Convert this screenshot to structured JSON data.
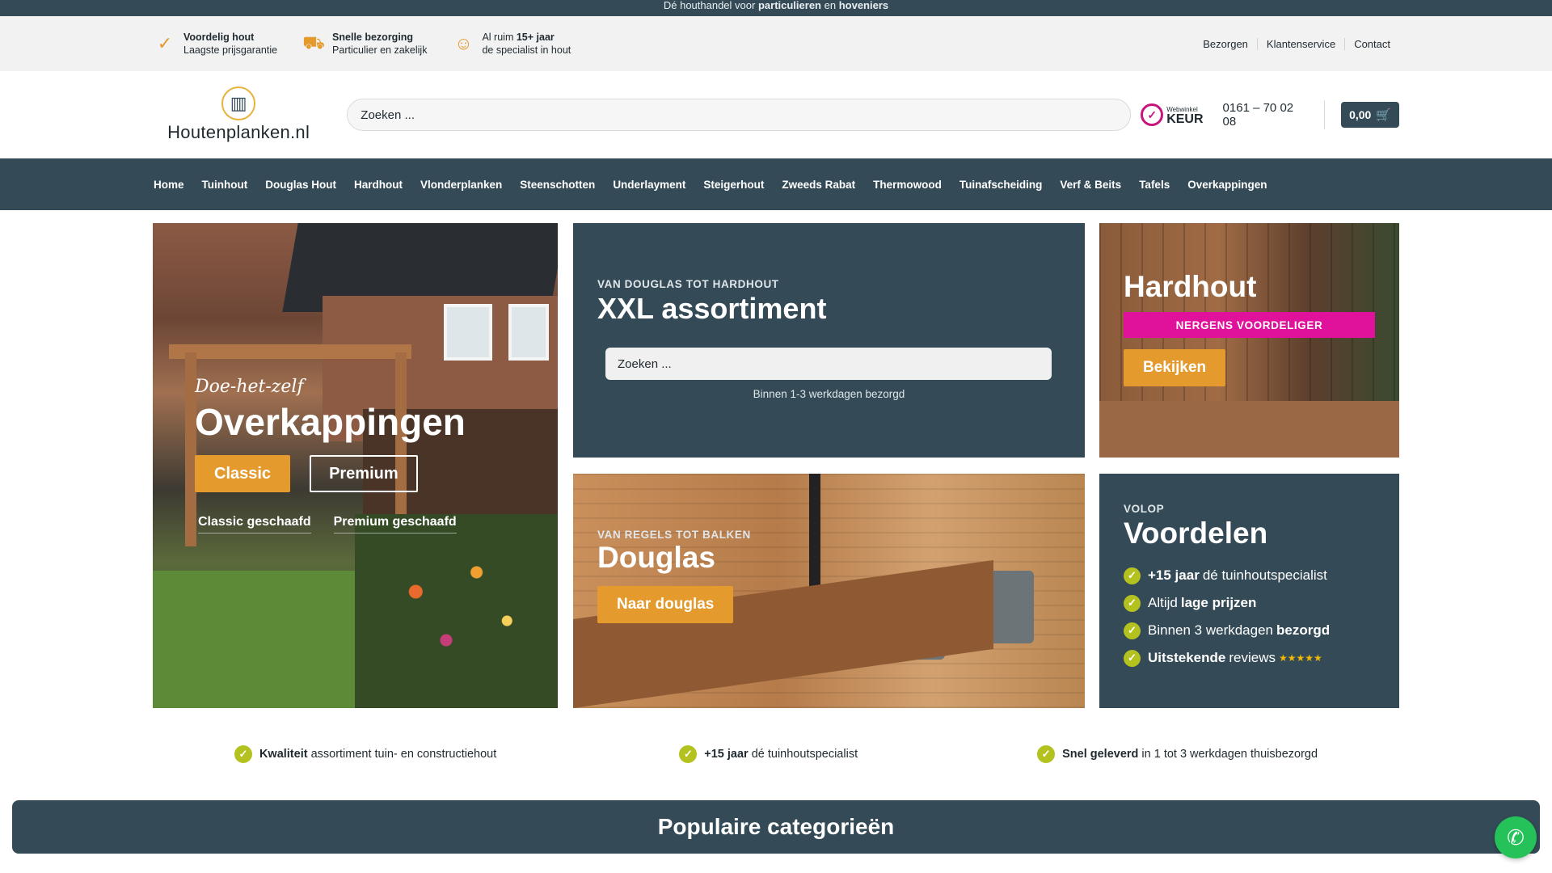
{
  "top_strip": {
    "pre": "Dé houthandel voor",
    "b1": "particulieren",
    "mid": "en",
    "b2": "hoveniers"
  },
  "usps": [
    {
      "icon": "check-icon",
      "title": "Voordelig hout",
      "sub": "Laagste prijsgarantie"
    },
    {
      "icon": "truck-icon",
      "title": "Snelle bezorging",
      "sub": "Particulier en zakelijk"
    },
    {
      "icon": "smiley-icon",
      "pre": "Al ruim",
      "bold": "15+ jaar",
      "sub": "de specialist in hout"
    }
  ],
  "top_links": [
    "Bezorgen",
    "Klantenservice",
    "Contact"
  ],
  "header": {
    "logo_text": "Houtenplanken.nl",
    "search_placeholder": "Zoeken ...",
    "keur_small": "Webwinkel",
    "keur_big": "KEUR",
    "phone": "0161 – 70 02 08",
    "cart_total": "0,00"
  },
  "nav": [
    "Home",
    "Tuinhout",
    "Douglas Hout",
    "Hardhout",
    "Vlonderplanken",
    "Steenschotten",
    "Underlayment",
    "Steigerhout",
    "Zweeds Rabat",
    "Thermowood",
    "Tuinafscheiding",
    "Verf & Beits",
    "Tafels",
    "Overkappingen"
  ],
  "hero_left": {
    "script": "Doe-het-zelf",
    "title": "Overkappingen",
    "btn_classic": "Classic",
    "btn_premium": "Premium",
    "link_classic": "Classic geschaafd",
    "link_premium": "Premium geschaafd"
  },
  "hero_mid_top": {
    "kicker": "VAN DOUGLAS TOT HARDHOUT",
    "title": "XXL assortiment",
    "search_placeholder": "Zoeken ...",
    "note": "Binnen 1-3 werkdagen bezorgd"
  },
  "hero_right_top": {
    "title": "Hardhout",
    "badge": "NERGENS VOORDELIGER",
    "button": "Bekijken"
  },
  "hero_mid_bot": {
    "kicker": "VAN REGELS TOT BALKEN",
    "title": "Douglas",
    "button": "Naar douglas"
  },
  "hero_right_bot": {
    "kicker": "VOLOP",
    "title": "Voordelen",
    "items": [
      {
        "b1": "+15 jaar",
        "rest": "dé tuinhoutspecialist"
      },
      {
        "pre": "Altijd",
        "b1": "lage prijzen"
      },
      {
        "pre": "Binnen 3 werkdagen",
        "b1": "bezorgd"
      },
      {
        "b1": "Uitstekende",
        "rest": "reviews",
        "stars": "★★★★★"
      }
    ]
  },
  "usp_row": [
    {
      "bold": "Kwaliteit",
      "rest": "assortiment tuin- en constructiehout"
    },
    {
      "bold": "+15 jaar",
      "rest": "dé tuinhoutspecialist"
    },
    {
      "bold": "Snel geleverd",
      "rest": "in 1 tot 3 werkdagen thuisbezorgd"
    }
  ],
  "categories_title": "Populaire categorieën",
  "colors": {
    "primary": "#344b57",
    "accent": "#e49a2d",
    "pink": "#e0119a",
    "check": "#b4c21f",
    "whatsapp": "#25c25a"
  }
}
